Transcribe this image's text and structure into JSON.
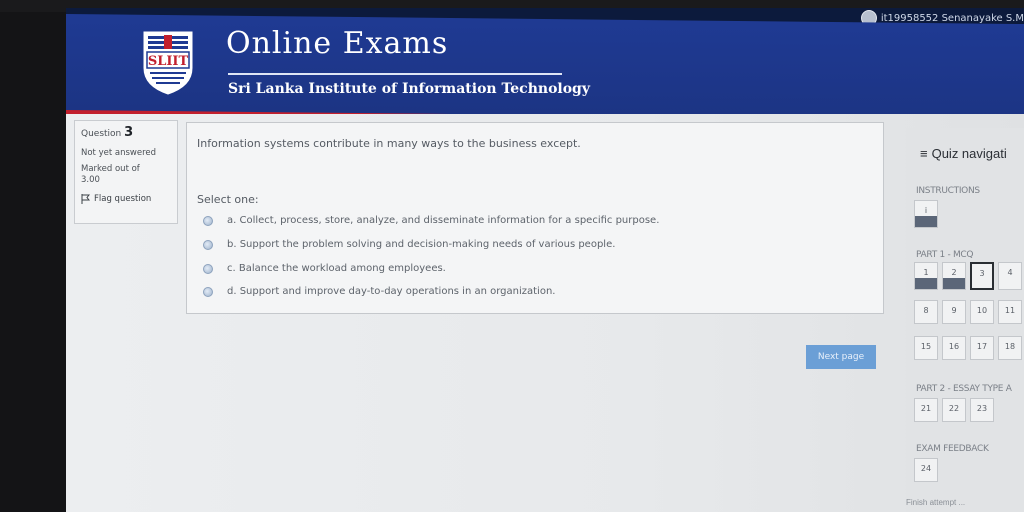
{
  "user": {
    "name": "it19958552 Senanayake S.M"
  },
  "header": {
    "title": "Online Exams",
    "subtitle": "Sri Lanka Institute of Information Technology",
    "logo_text": "SLIIT"
  },
  "question_info": {
    "label": "Question",
    "number": "3",
    "status": "Not yet answered",
    "marked_label": "Marked out of",
    "marked_value": "3.00",
    "flag_label": "Flag question"
  },
  "question": {
    "text": "Information systems contribute in many ways to the business except.",
    "select_label": "Select one:",
    "options": [
      {
        "label": "a. Collect, process, store, analyze, and disseminate information for a specific purpose."
      },
      {
        "label": "b. Support the problem solving and decision-making needs of various people."
      },
      {
        "label": "c. Balance the workload among employees."
      },
      {
        "label": "d. Support and improve day-to-day operations in an organization."
      }
    ]
  },
  "buttons": {
    "next": "Next page"
  },
  "nav": {
    "title": "Quiz navigati",
    "instructions": "INSTRUCTIONS",
    "part1": "PART 1 - MCQ",
    "part2": "PART 2 - ESSAY TYPE A",
    "feedback": "EXAM FEEDBACK",
    "finish": "Finish attempt ...",
    "instr_items": [
      "i"
    ],
    "part1_row1": [
      "1",
      "2",
      "3",
      "4"
    ],
    "part1_row2": [
      "8",
      "9",
      "10",
      "11"
    ],
    "part1_row3": [
      "15",
      "16",
      "17",
      "18"
    ],
    "part2_items": [
      "21",
      "22",
      "23"
    ],
    "feedback_items": [
      "24"
    ],
    "answered": [
      "i",
      "1",
      "2"
    ],
    "current": "3"
  },
  "colors": {
    "header_blue": "#1f3a93",
    "header_accent": "#c21f2d",
    "next_button": "#6b9fd6"
  }
}
